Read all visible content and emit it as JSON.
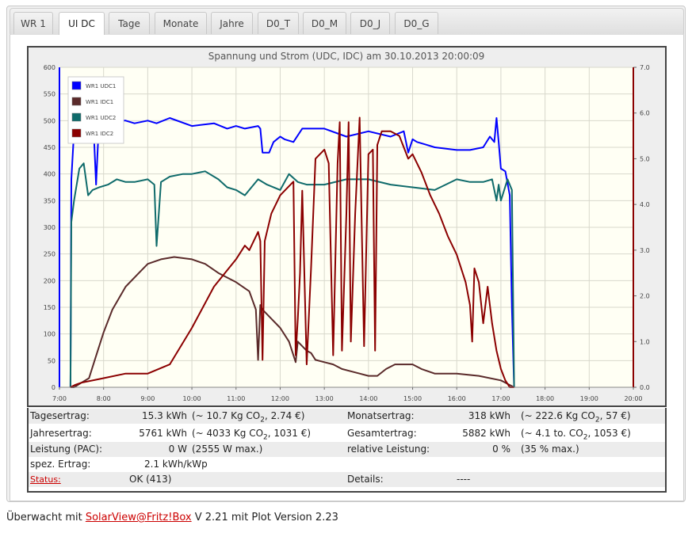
{
  "tabs": [
    {
      "label": "WR 1",
      "active": false
    },
    {
      "label": "UI DC",
      "active": true
    },
    {
      "label": "Tage",
      "active": false
    },
    {
      "label": "Monate",
      "active": false
    },
    {
      "label": "Jahre",
      "active": false
    },
    {
      "label": "D0_T",
      "active": false
    },
    {
      "label": "D0_M",
      "active": false
    },
    {
      "label": "D0_J",
      "active": false
    },
    {
      "label": "D0_G",
      "active": false
    }
  ],
  "chart_data": {
    "type": "line",
    "title": "Spannung und Strom (UDC, IDC) am 30.10.2013 20:00:09",
    "xticks": [
      "7:00",
      "8:00",
      "9:00",
      "10:00",
      "11:00",
      "12:00",
      "13:00",
      "14:00",
      "15:00",
      "16:00",
      "17:00",
      "18:00",
      "19:00",
      "20:00"
    ],
    "xlim": [
      7,
      20
    ],
    "y_left": {
      "lim": [
        0,
        600
      ],
      "ticks": [
        "0",
        "50",
        "100",
        "150",
        "200",
        "250",
        "300",
        "350",
        "400",
        "450",
        "500",
        "550",
        "600"
      ]
    },
    "y_right": {
      "lim": [
        0,
        7
      ],
      "ticks": [
        "0.0",
        "1.0",
        "2.0",
        "3.0",
        "4.0",
        "5.0",
        "6.0",
        "7.0"
      ]
    },
    "grid": true,
    "legend_position": "top-left",
    "series": [
      {
        "name": "WR1 UDC1",
        "axis": "left",
        "color": "#0000ff",
        "x": [
          7.25,
          7.27,
          7.33,
          7.42,
          7.5,
          7.58,
          7.67,
          7.75,
          7.83,
          7.88,
          7.92,
          8.0,
          8.1,
          8.3,
          8.5,
          8.7,
          9.0,
          9.2,
          9.5,
          10.0,
          10.5,
          10.8,
          11.0,
          11.2,
          11.5,
          11.55,
          11.6,
          11.75,
          11.85,
          12.0,
          12.1,
          12.3,
          12.5,
          13.0,
          13.5,
          14.0,
          14.5,
          14.8,
          14.9,
          15.0,
          15.1,
          15.3,
          15.5,
          16.0,
          16.3,
          16.6,
          16.75,
          16.85,
          16.9,
          16.95,
          17.0,
          17.1,
          17.2,
          17.25,
          17.3
        ],
        "y": [
          0,
          390,
          480,
          550,
          535,
          540,
          535,
          530,
          380,
          470,
          515,
          505,
          500,
          500,
          500,
          495,
          500,
          495,
          505,
          490,
          495,
          485,
          490,
          485,
          490,
          485,
          440,
          440,
          460,
          470,
          465,
          460,
          485,
          485,
          470,
          480,
          470,
          480,
          440,
          465,
          460,
          455,
          450,
          445,
          445,
          450,
          470,
          460,
          505,
          460,
          410,
          405,
          360,
          150,
          0
        ]
      },
      {
        "name": "WR1 IDC1",
        "axis": "right",
        "color": "#5a2a2a",
        "x": [
          7.25,
          7.33,
          7.5,
          7.67,
          7.8,
          8.0,
          8.2,
          8.5,
          8.8,
          9.0,
          9.3,
          9.6,
          10.0,
          10.3,
          10.6,
          11.0,
          11.3,
          11.45,
          11.5,
          11.55,
          11.6,
          11.8,
          12.0,
          12.2,
          12.3,
          12.35,
          12.4,
          12.5,
          12.6,
          12.7,
          12.8,
          13.0,
          13.2,
          13.4,
          13.6,
          13.8,
          14.0,
          14.2,
          14.4,
          14.6,
          14.8,
          15.0,
          15.2,
          15.5,
          16.0,
          16.5,
          17.0,
          17.2,
          17.3
        ],
        "y": [
          0,
          0.0,
          0.1,
          0.2,
          0.6,
          1.2,
          1.7,
          2.2,
          2.5,
          2.7,
          2.8,
          2.85,
          2.8,
          2.7,
          2.5,
          2.3,
          2.1,
          1.7,
          0.6,
          1.8,
          1.7,
          1.5,
          1.3,
          1.0,
          0.7,
          0.55,
          1.0,
          0.9,
          0.8,
          0.75,
          0.6,
          0.55,
          0.5,
          0.4,
          0.35,
          0.3,
          0.25,
          0.25,
          0.4,
          0.5,
          0.5,
          0.5,
          0.4,
          0.3,
          0.3,
          0.25,
          0.15,
          0.05,
          0
        ]
      },
      {
        "name": "WR1 UDC2",
        "axis": "left",
        "color": "#0f6b6b",
        "x": [
          7.25,
          7.27,
          7.33,
          7.45,
          7.55,
          7.65,
          7.75,
          7.9,
          8.1,
          8.3,
          8.5,
          8.7,
          9.0,
          9.15,
          9.2,
          9.3,
          9.5,
          9.8,
          10.0,
          10.3,
          10.6,
          10.8,
          11.0,
          11.2,
          11.5,
          11.7,
          12.0,
          12.2,
          12.4,
          12.6,
          13.0,
          13.5,
          14.0,
          14.5,
          15.0,
          15.5,
          16.0,
          16.3,
          16.6,
          16.8,
          16.9,
          16.95,
          17.0,
          17.15,
          17.25,
          17.3
        ],
        "y": [
          0,
          310,
          350,
          410,
          420,
          360,
          370,
          375,
          380,
          390,
          385,
          385,
          390,
          380,
          265,
          385,
          395,
          400,
          400,
          405,
          390,
          375,
          370,
          360,
          390,
          380,
          370,
          400,
          385,
          380,
          380,
          390,
          390,
          380,
          375,
          370,
          390,
          385,
          385,
          390,
          350,
          380,
          350,
          390,
          370,
          0
        ]
      },
      {
        "name": "WR1 IDC2",
        "axis": "right",
        "color": "#8b0000",
        "x": [
          7.25,
          7.35,
          7.5,
          8.0,
          8.5,
          9.0,
          9.5,
          10.0,
          10.5,
          11.0,
          11.2,
          11.3,
          11.5,
          11.55,
          11.6,
          11.65,
          11.8,
          12.0,
          12.2,
          12.3,
          12.35,
          12.4,
          12.45,
          12.5,
          12.6,
          12.7,
          12.8,
          13.0,
          13.1,
          13.2,
          13.3,
          13.35,
          13.4,
          13.5,
          13.55,
          13.6,
          13.7,
          13.8,
          13.9,
          14.0,
          14.1,
          14.15,
          14.2,
          14.3,
          14.5,
          14.7,
          14.9,
          15.0,
          15.2,
          15.4,
          15.6,
          15.8,
          16.0,
          16.2,
          16.3,
          16.35,
          16.4,
          16.5,
          16.6,
          16.7,
          16.8,
          16.9,
          17.0,
          17.1,
          17.2,
          17.3
        ],
        "y": [
          0,
          0.05,
          0.1,
          0.2,
          0.3,
          0.3,
          0.5,
          1.3,
          2.2,
          2.8,
          3.1,
          3.0,
          3.4,
          3.2,
          0.6,
          3.2,
          3.8,
          4.2,
          4.4,
          4.5,
          0.7,
          1.5,
          2.5,
          4.3,
          0.5,
          2.6,
          5.0,
          5.2,
          4.9,
          0.7,
          4.9,
          5.8,
          0.8,
          3.8,
          5.8,
          1.0,
          3.8,
          5.9,
          0.9,
          5.1,
          5.2,
          0.8,
          5.3,
          5.6,
          5.6,
          5.5,
          5.0,
          5.1,
          4.7,
          4.2,
          3.8,
          3.3,
          2.9,
          2.3,
          1.8,
          1.0,
          2.6,
          2.3,
          1.4,
          2.2,
          1.4,
          0.8,
          0.4,
          0.15,
          0.0,
          0
        ]
      }
    ]
  },
  "info": {
    "tagesertrag": {
      "label": "Tagesertrag:",
      "value": "15.3 kWh",
      "note_pre": "(~ 10.7 Kg CO",
      "note_sub": "2",
      "note_post": ", 2.74 €)"
    },
    "monatsertrag": {
      "label": "Monatsertrag:",
      "value": "318 kWh",
      "note_pre": "(~ 222.6 Kg CO",
      "note_sub": "2",
      "note_post": ", 57 €)"
    },
    "jahresertrag": {
      "label": "Jahresertrag:",
      "value": "5761 kWh",
      "note_pre": "(~ 4033 Kg CO",
      "note_sub": "2",
      "note_post": ", 1031 €)"
    },
    "gesamtertrag": {
      "label": "Gesamtertrag:",
      "value": "5882 kWh",
      "note_pre": "(~ 4.1 to. CO",
      "note_sub": "2",
      "note_post": ", 1053 €)"
    },
    "leistung": {
      "label": "Leistung (PAC):",
      "value": "0 W",
      "note": "(2555 W max.)"
    },
    "relative": {
      "label": "relative Leistung:",
      "value": "0 %",
      "note": "(35 % max.)"
    },
    "spez": {
      "label": "spez. Ertrag:",
      "value": "2.1 kWh/kWp"
    },
    "status": {
      "label": "Status:",
      "value": "OK (413)"
    },
    "details": {
      "label": "Details:",
      "value": "----"
    }
  },
  "footer": {
    "prefix": "Überwacht mit ",
    "link": "SolarView@Fritz!Box",
    "suffix": " V 2.21 mit Plot Version 2.23"
  }
}
